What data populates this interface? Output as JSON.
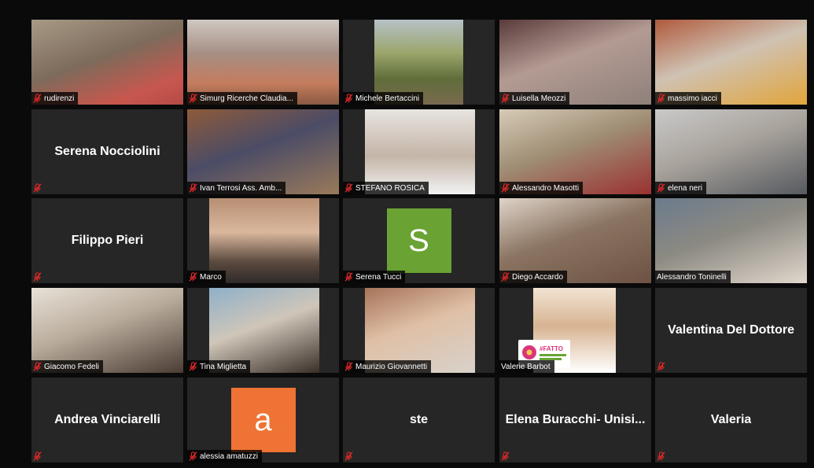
{
  "meeting": {
    "participants": [
      {
        "name": "rudirenzi",
        "muted": true,
        "video": true
      },
      {
        "name": "Simurg Ricerche Claudia...",
        "muted": true,
        "video": true
      },
      {
        "name": "Michele Bertaccini",
        "muted": true,
        "video": true
      },
      {
        "name": "Luisella Meozzi",
        "muted": true,
        "video": true
      },
      {
        "name": "massimo iacci",
        "muted": true,
        "video": true
      },
      {
        "name": "Serena Nocciolini",
        "muted": true,
        "video": false
      },
      {
        "name": "Ivan Terrosi Ass. Amb...",
        "muted": true,
        "video": true
      },
      {
        "name": "STEFANO ROSICA",
        "muted": true,
        "video": true
      },
      {
        "name": "Alessandro Masotti",
        "muted": true,
        "video": true
      },
      {
        "name": "elena neri",
        "muted": true,
        "video": true
      },
      {
        "name": "Filippo Pieri",
        "muted": true,
        "video": false
      },
      {
        "name": "Marco",
        "muted": true,
        "video": true
      },
      {
        "name": "Serena Tucci",
        "muted": true,
        "video": false,
        "avatar_letter": "S",
        "avatar_color": "#6aa333"
      },
      {
        "name": "Diego Accardo",
        "muted": true,
        "video": true
      },
      {
        "name": "Alessandro Toninelli",
        "muted": false,
        "video": true,
        "active_speaker": true
      },
      {
        "name": "Giacomo Fedeli",
        "muted": true,
        "video": true
      },
      {
        "name": "Tina Miglietta",
        "muted": true,
        "video": true
      },
      {
        "name": "Maurizio Giovannetti",
        "muted": true,
        "video": true
      },
      {
        "name": "Valerie Barbot",
        "muted": false,
        "video": true
      },
      {
        "name": "Valentina Del Dottore",
        "muted": true,
        "video": false
      },
      {
        "name": "Andrea Vinciarelli",
        "muted": true,
        "video": false
      },
      {
        "name": "alessia amatuzzi",
        "muted": true,
        "video": false,
        "avatar_letter": "a",
        "avatar_color": "#ee7334"
      },
      {
        "name": "ste",
        "muted": true,
        "video": false
      },
      {
        "name": "Elena Buracchi- Unisi...",
        "muted": true,
        "video": false
      },
      {
        "name": "Valeria",
        "muted": true,
        "video": false
      }
    ]
  },
  "fatto_badge": {
    "hashtag": "#FATTO"
  },
  "colors": {
    "active_border": "#d8d95b",
    "muted_icon": "#e02828",
    "tile_bg": "#262626"
  },
  "icons": {
    "mute": "mic-muted-icon"
  }
}
